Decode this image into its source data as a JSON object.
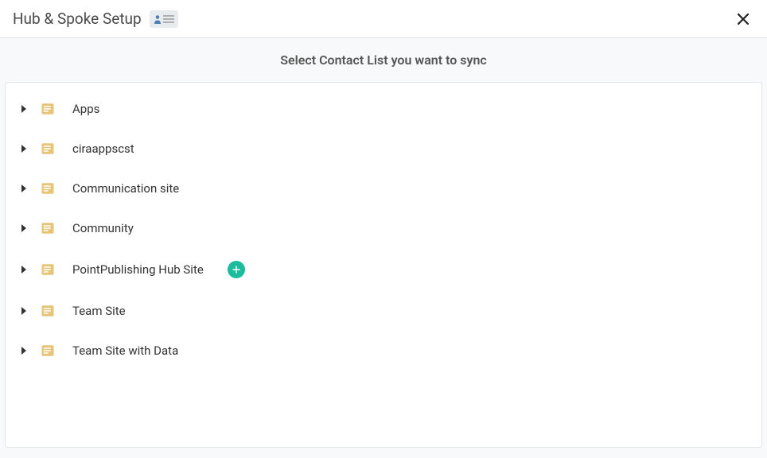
{
  "header": {
    "title": "Hub & Spoke Setup"
  },
  "instruction": "Select Contact List you want to sync",
  "tree": {
    "items": [
      {
        "label": "Apps",
        "showAdd": false
      },
      {
        "label": "ciraappscst",
        "showAdd": false
      },
      {
        "label": "Communication site",
        "showAdd": false
      },
      {
        "label": "Community",
        "showAdd": false
      },
      {
        "label": "PointPublishing Hub Site",
        "showAdd": true
      },
      {
        "label": "Team Site",
        "showAdd": false
      },
      {
        "label": "Team Site with Data",
        "showAdd": false
      }
    ]
  },
  "colors": {
    "folder": "#e6c478",
    "addButton": "#1abc9c"
  }
}
